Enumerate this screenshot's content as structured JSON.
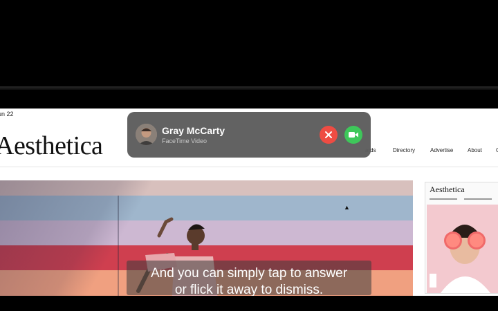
{
  "status_bar": {
    "date": "un 22"
  },
  "site": {
    "logo": "Aesthetica",
    "nav": [
      "ards",
      "Directory",
      "Advertise",
      "About",
      "C"
    ]
  },
  "sidebar_card": {
    "logo": "Aesthetica"
  },
  "notification": {
    "caller_name": "Gray McCarty",
    "call_type": "FaceTime Video",
    "decline_icon": "close-icon",
    "accept_icon": "video-camera-icon",
    "decline_color": "#ee4c43",
    "accept_color": "#3ec75a"
  },
  "captions": {
    "line1": "And you can simply tap to answer",
    "line2": "or flick it away to dismiss."
  }
}
